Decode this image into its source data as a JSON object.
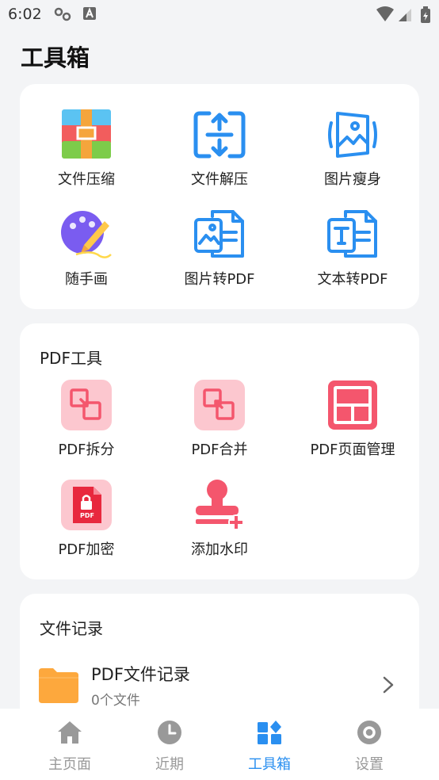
{
  "status_bar": {
    "time": "6:02"
  },
  "page_title": "工具箱",
  "tools_card": {
    "items": [
      {
        "label": "文件压缩",
        "icon": "archive-icon"
      },
      {
        "label": "文件解压",
        "icon": "unzip-icon"
      },
      {
        "label": "图片瘦身",
        "icon": "image-compress-icon"
      },
      {
        "label": "随手画",
        "icon": "palette-icon"
      },
      {
        "label": "图片转PDF",
        "icon": "image-to-pdf-icon"
      },
      {
        "label": "文本转PDF",
        "icon": "text-to-pdf-icon"
      }
    ]
  },
  "pdf_card": {
    "title": "PDF工具",
    "items": [
      {
        "label": "PDF拆分",
        "icon": "pdf-split-icon"
      },
      {
        "label": "PDF合并",
        "icon": "pdf-merge-icon"
      },
      {
        "label": "PDF页面管理",
        "icon": "pdf-page-manage-icon"
      },
      {
        "label": "PDF加密",
        "icon": "pdf-lock-icon"
      },
      {
        "label": "添加水印",
        "icon": "watermark-stamp-icon"
      }
    ],
    "lock_text": "PDF"
  },
  "records_card": {
    "title": "文件记录",
    "row": {
      "name": "PDF文件记录",
      "count": "0个文件"
    }
  },
  "bottom_nav": {
    "items": [
      {
        "label": "主页面",
        "icon": "home-icon"
      },
      {
        "label": "近期",
        "icon": "clock-icon"
      },
      {
        "label": "工具箱",
        "icon": "toolbox-icon",
        "active": true
      },
      {
        "label": "设置",
        "icon": "settings-icon"
      }
    ]
  },
  "colors": {
    "accent": "#2a8ff0",
    "pink": "#f4566d",
    "pink_bg": "#fcc7cf",
    "folder": "#fda83d",
    "inactive": "#999999"
  }
}
